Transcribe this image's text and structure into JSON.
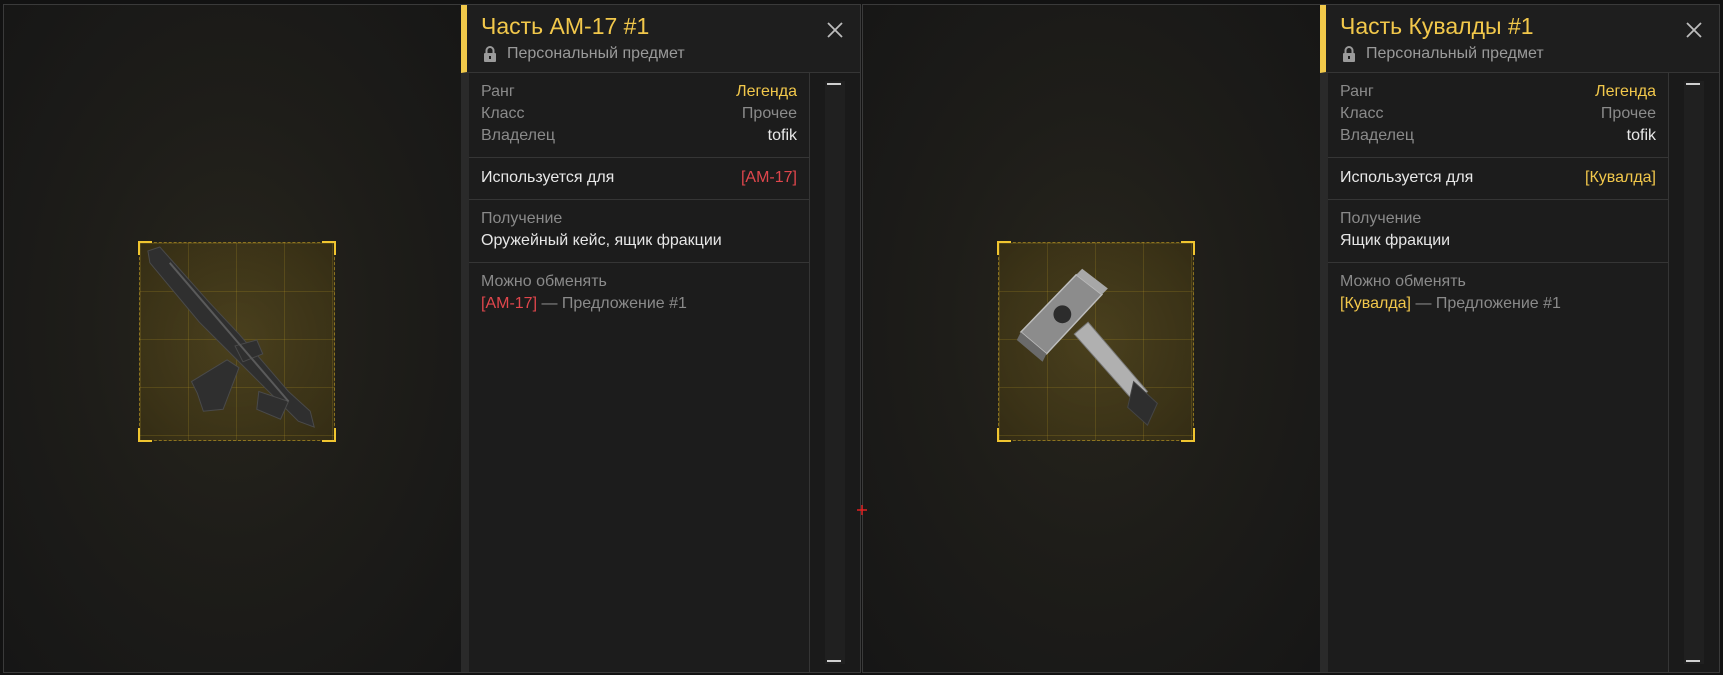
{
  "cards": [
    {
      "title": "Часть АМ-17 #1",
      "subtitle": "Персональный предмет",
      "rank_label": "Ранг",
      "rank_value": "Легенда",
      "class_label": "Класс",
      "class_value": "Прочее",
      "owner_label": "Владелец",
      "owner_value": "tofik",
      "used_for_label": "Используется для",
      "used_for_value": "[АМ-17]",
      "used_for_color": "#e0464c",
      "obtain_label": "Получение",
      "obtain_value": "Оружейный кейс, ящик фракции",
      "exchange_label": "Можно обменять",
      "exchange_item": "[АМ-17]",
      "exchange_suffix": " — Предложение #1",
      "icon": "rifle-icon"
    },
    {
      "title": "Часть Кувалды #1",
      "subtitle": "Персональный предмет",
      "rank_label": "Ранг",
      "rank_value": "Легенда",
      "class_label": "Класс",
      "class_value": "Прочее",
      "owner_label": "Владелец",
      "owner_value": "tofik",
      "used_for_label": "Используется для",
      "used_for_value": "[Кувалда]",
      "used_for_color": "#f2c84b",
      "obtain_label": "Получение",
      "obtain_value": "Ящик фракции",
      "exchange_label": "Можно обменять",
      "exchange_item": "[Кувалда]",
      "exchange_suffix": " — Предложение #1",
      "icon": "sledgehammer-icon"
    }
  ],
  "colors": {
    "accent": "#f1c94a",
    "legend": "#f2c84b",
    "weapon_red": "#e0464c"
  }
}
